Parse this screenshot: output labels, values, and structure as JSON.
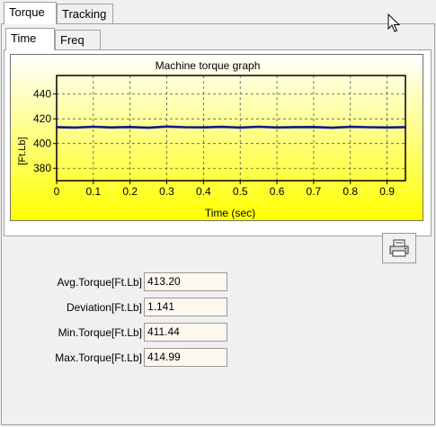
{
  "tabs": {
    "top": [
      "Torque",
      "Tracking"
    ],
    "sub": [
      "Time",
      "Freq"
    ]
  },
  "chart": {
    "title": "Machine torque graph",
    "xlabel": "Time (sec)",
    "ylabel": "[Ft.Lb]",
    "xticks": [
      "0",
      "0.1",
      "0.2",
      "0.3",
      "0.4",
      "0.5",
      "0.6",
      "0.7",
      "0.8",
      "0.9"
    ],
    "yticks": [
      "440",
      "420",
      "400",
      "380"
    ]
  },
  "chart_data": {
    "type": "line",
    "title": "Machine torque graph",
    "xlabel": "Time (sec)",
    "ylabel": "[Ft.Lb]",
    "xlim": [
      0,
      0.95
    ],
    "ylim": [
      370,
      455
    ],
    "x_ticks": [
      0,
      0.1,
      0.2,
      0.3,
      0.4,
      0.5,
      0.6,
      0.7,
      0.8,
      0.9
    ],
    "y_ticks": [
      380,
      400,
      420,
      440
    ],
    "grid": true,
    "background": [
      "#ffffff",
      "#ffff00"
    ],
    "line_color": "#0a1a8a",
    "series": [
      {
        "x": [
          0,
          0.05,
          0.1,
          0.15,
          0.2,
          0.25,
          0.3,
          0.35,
          0.4,
          0.45,
          0.5,
          0.55,
          0.6,
          0.65,
          0.7,
          0.75,
          0.8,
          0.85,
          0.9,
          0.95
        ],
        "values": [
          413.3,
          412.9,
          413.6,
          413.0,
          413.4,
          412.8,
          413.7,
          413.2,
          413.1,
          413.5,
          412.9,
          413.6,
          413.0,
          413.3,
          413.4,
          412.8,
          413.5,
          413.2,
          413.0,
          413.3
        ]
      }
    ]
  },
  "stats": [
    {
      "label": "Avg.Torque[Ft.Lb]",
      "value": "413.20"
    },
    {
      "label": "Deviation[Ft.Lb]",
      "value": "1.141"
    },
    {
      "label": "Min.Torque[Ft.Lb]",
      "value": "411.44"
    },
    {
      "label": "Max.Torque[Ft.Lb]",
      "value": "414.99"
    }
  ],
  "icons": {
    "print": "printer-icon",
    "cursor": "mouse-pointer-icon"
  }
}
